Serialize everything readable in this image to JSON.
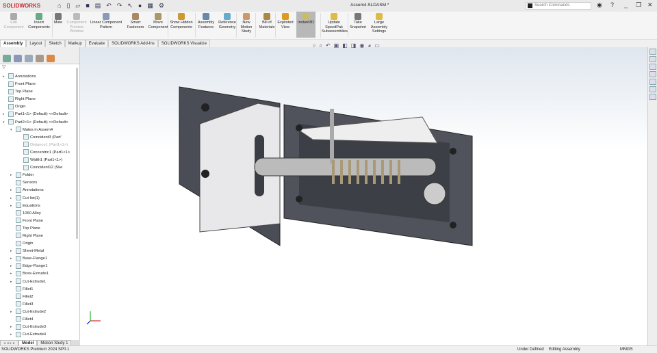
{
  "app": {
    "brand": "SOLIDWORKS",
    "document_title": "Assem4.SLDASM *",
    "search_placeholder": "Search Commands"
  },
  "quick_access": [
    "home-icon",
    "new-icon",
    "open-icon",
    "save-icon",
    "print-icon",
    "undo-icon",
    "redo-icon",
    "select-icon",
    "traffic-light-icon",
    "file-properties-icon",
    "options-icon"
  ],
  "ribbon": [
    {
      "label": "Edit Component",
      "disabled": true
    },
    {
      "label": "Insert Components"
    },
    {
      "label": "Mate"
    },
    {
      "label": "Component Preview Window",
      "disabled": true
    },
    {
      "label": "Linear Component Pattern"
    },
    {
      "label": "Smart Fasteners"
    },
    {
      "label": "Move Component"
    },
    {
      "label": "Show Hidden Components"
    },
    {
      "label": "Assembly Features"
    },
    {
      "label": "Reference Geometry"
    },
    {
      "label": "New Motion Study"
    },
    {
      "label": "Bill of Materials"
    },
    {
      "label": "Exploded View"
    },
    {
      "label": "Instant3D",
      "active": true
    },
    {
      "label": "Update SpeedPak Subassemblies"
    },
    {
      "label": "Take Snapshot"
    },
    {
      "label": "Large Assembly Settings"
    }
  ],
  "command_tabs": [
    "Assembly",
    "Layout",
    "Sketch",
    "Markup",
    "Evaluate",
    "SOLIDWORKS Add-Ins",
    "SOLIDWORKS Visualize"
  ],
  "tree": [
    {
      "label": "Annotations",
      "level": 0,
      "exp": true
    },
    {
      "label": "Front Plane",
      "level": 0
    },
    {
      "label": "Top Plane",
      "level": 0
    },
    {
      "label": "Right Plane",
      "level": 0
    },
    {
      "label": "Origin",
      "level": 0
    },
    {
      "label": "Part1<1> (Default) <<Default>",
      "level": 0,
      "exp": true
    },
    {
      "label": "Part2<1> (Default) <<Default>",
      "level": 0,
      "exp": true,
      "open": true
    },
    {
      "label": "Mates in Assem4",
      "level": 1,
      "exp": true,
      "open": true
    },
    {
      "label": "Coincident3 (Part'",
      "level": 2
    },
    {
      "label": "Distance1 (Part1<1>)",
      "level": 2,
      "dim": true
    },
    {
      "label": "Concentric1 (Part1<1>",
      "level": 2
    },
    {
      "label": "Width1 (Part1<1>)",
      "level": 2
    },
    {
      "label": "Coincident12 (Ske",
      "level": 2
    },
    {
      "label": "Folder",
      "level": 1,
      "exp": true
    },
    {
      "label": "Sensors",
      "level": 1
    },
    {
      "label": "Annotations",
      "level": 1,
      "exp": true
    },
    {
      "label": "Cut list(1)",
      "level": 1,
      "exp": true
    },
    {
      "label": "Equations",
      "level": 1,
      "exp": true
    },
    {
      "label": "1060 Alloy",
      "level": 1
    },
    {
      "label": "Front Plane",
      "level": 1
    },
    {
      "label": "Top Plane",
      "level": 1
    },
    {
      "label": "Right Plane",
      "level": 1
    },
    {
      "label": "Origin",
      "level": 1
    },
    {
      "label": "Sheet-Metal",
      "level": 1,
      "exp": true
    },
    {
      "label": "Base-Flange1",
      "level": 1,
      "exp": true
    },
    {
      "label": "Edge-Flange1",
      "level": 1,
      "exp": true
    },
    {
      "label": "Boss-Extrude1",
      "level": 1,
      "exp": true
    },
    {
      "label": "Cut-Extrude1",
      "level": 1,
      "exp": true
    },
    {
      "label": "Fillet1",
      "level": 1
    },
    {
      "label": "Fillet2",
      "level": 1
    },
    {
      "label": "Fillet3",
      "level": 1
    },
    {
      "label": "Cut-Extrude2",
      "level": 1,
      "exp": true
    },
    {
      "label": "Fillet4",
      "level": 1
    },
    {
      "label": "Cut-Extrude3",
      "level": 1,
      "exp": true
    },
    {
      "label": "Cut-Extrude4",
      "level": 1,
      "exp": true
    }
  ],
  "bottom_tabs": [
    "Model",
    "Motion Study 1"
  ],
  "status": {
    "product": "SOLIDWORKS Premium 2024 SP0.1",
    "definition": "Under Defined",
    "mode": "Editing Assembly",
    "units": "MMGS"
  }
}
